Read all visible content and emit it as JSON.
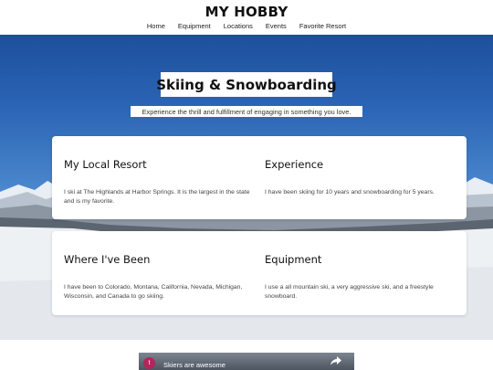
{
  "site": {
    "title": "MY HOBBY"
  },
  "nav": {
    "items": [
      "Home",
      "Equipment",
      "Locations",
      "Events",
      "Favorite Resort"
    ]
  },
  "hero": {
    "title": "Skiing & Snowboarding",
    "subtitle": "Experience the thrill and fulfillment of engaging in something you love."
  },
  "cards": [
    {
      "left": {
        "heading": "My Local Resort",
        "text": "I ski at The Highlands at Harbor Springs. It is the largest in the state and is my favorite."
      },
      "right": {
        "heading": "Experience",
        "text": "I have been skiing for 10 years and snowboarding for 5 years."
      }
    },
    {
      "left": {
        "heading": "Where I've Been",
        "text": "I have been to Colorado, Montana, California, Nevada, Michigan, Wisconsin, and Canada to go skiing."
      },
      "right": {
        "heading": "Equipment",
        "text": "I use a all mountain ski, a very aggressive ski, and a freestyle snowboard."
      }
    }
  ],
  "video": {
    "avatar_letter": "t",
    "title": "Skiers are awesome",
    "share_icon": "share-icon"
  },
  "colors": {
    "avatar": "#b5245a",
    "sky_top": "#1d4f9c",
    "card_bg": "#ffffff"
  }
}
